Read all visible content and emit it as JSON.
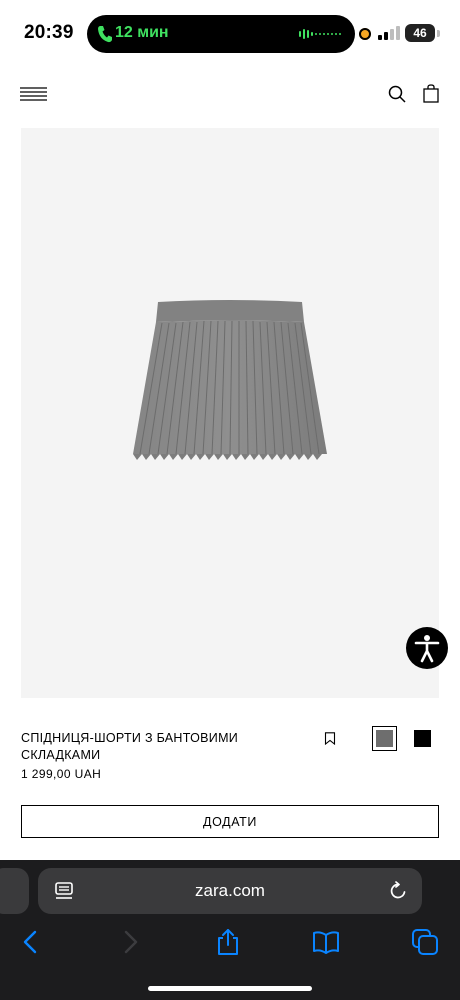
{
  "status_bar": {
    "time": "20:39",
    "call_duration": "12 мин",
    "battery": "46",
    "icons": [
      "phone-icon",
      "audio-wave-icon",
      "signal-icon",
      "battery-icon"
    ]
  },
  "header": {
    "icons": [
      "menu-icon",
      "search-icon",
      "shopping-bag-icon"
    ]
  },
  "product": {
    "name": "СПІДНИЦЯ-ШОРТИ З БАНТОВИМИ СКЛАДКАМИ",
    "price": "1 299,00 UAH",
    "colors": [
      "#6e6e6e",
      "#000000"
    ],
    "selected_color": "#6e6e6e",
    "add_button_label": "ДОДАТИ"
  },
  "browser": {
    "url": "zara.com",
    "icons": [
      "page-menu-icon",
      "reload-icon",
      "back-icon",
      "forward-icon",
      "share-icon",
      "bookmarks-icon",
      "tabs-icon"
    ],
    "accent": "#0a84ff"
  },
  "accessibility_button": {
    "icon": "accessibility-icon"
  }
}
